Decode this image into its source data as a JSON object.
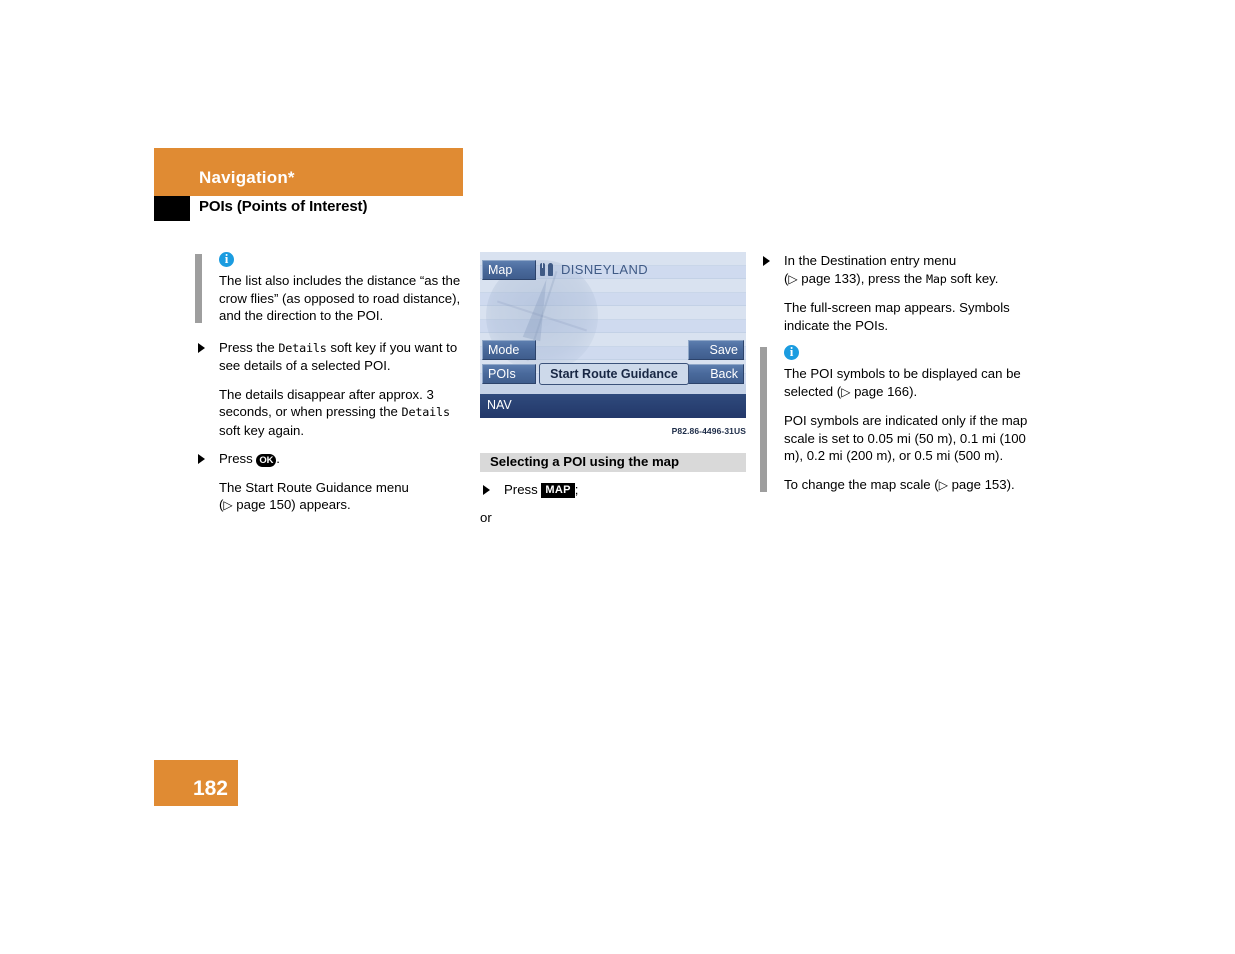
{
  "header": {
    "chapter_title": "Navigation*",
    "section_title": "POIs (Points of Interest)",
    "band_color": "#e08b33",
    "marker_color": "#000000"
  },
  "left_column": {
    "note": {
      "icon": "info-icon",
      "text": "The list also includes the distance “as the crow flies” (as opposed to road distance), and the direction to the POI."
    },
    "step1": {
      "prefix": "Press the ",
      "softkey": "Details",
      "suffix": " soft key if you want to see details of a selected POI."
    },
    "result1": {
      "prefix": "The details disappear after approx. 3 seconds, or when pressing the ",
      "softkey": "Details",
      "suffix": " soft key again."
    },
    "step2": {
      "prefix": "Press ",
      "key": "OK",
      "suffix": "."
    },
    "result2": {
      "line1": "The Start Route Guidance menu",
      "ref_open": "(",
      "ref_arrow": "▷",
      "ref_text": " page 150) appears."
    }
  },
  "middle_column": {
    "nav_screen": {
      "title": "DISNEYLAND",
      "poi_icon": "restaurant-icon",
      "soft_keys": {
        "map": "Map",
        "mode": "Mode",
        "pois": "POIs",
        "save": "Save",
        "back": "Back"
      },
      "center_button": "Start Route Guidance",
      "status_label": "NAV",
      "colors": {
        "screen_bg": "#cfdaec",
        "button": "#4a6a9c",
        "status_bar": "#2a4073",
        "title_text": "#3f5a85"
      }
    },
    "figure_caption": "P82.86-4496-31US",
    "subsection_title": "Selecting a POI using the map",
    "step1": {
      "prefix": "Press ",
      "key": "MAP",
      "suffix": ";"
    },
    "alternative": "or"
  },
  "right_column": {
    "step1": {
      "line1": "In the Destination entry menu",
      "ref_open": "(",
      "ref_arrow": "▷",
      "ref_mid": " page 133), press the ",
      "softkey": "Map",
      "suffix": " soft key."
    },
    "result1": "The full-screen map appears. Symbols indicate the POIs.",
    "note": {
      "icon": "info-icon",
      "para1_prefix": "The POI symbols to be displayed can be selected (",
      "para1_arrow": "▷",
      "para1_suffix": " page 166).",
      "para2": "POI symbols are indicated only if the map scale is set to 0.05 mi (50 m), 0.1 mi (100 m), 0.2 mi (200 m), or 0.5 mi (500 m).",
      "para3_prefix": "To change the map scale (",
      "para3_arrow": "▷",
      "para3_suffix": " page 153)."
    }
  },
  "footer": {
    "page_number": "182",
    "box_color": "#e08b33"
  }
}
